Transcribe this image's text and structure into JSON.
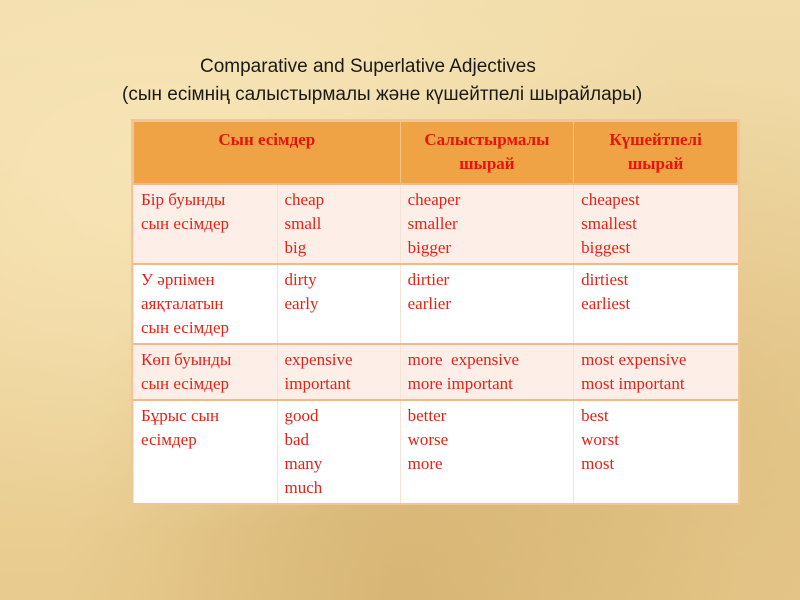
{
  "slide": {
    "title_en": "Comparative and Superlative Adjectives",
    "title_kz": "(сын есімнің салыстырмалы және күшейтпелі шырайлары)"
  },
  "table": {
    "headers": [
      "Сын есімдер",
      "Салыстырмалы шырай",
      "Күшейтпелі шырай"
    ],
    "rows": [
      {
        "category": [
          "Бір буынды",
          "сын есімдер"
        ],
        "base": [
          "cheap",
          "small",
          "big"
        ],
        "comparative": [
          "cheaper",
          "smaller",
          "bigger"
        ],
        "superlative": [
          "cheapest",
          "smallest",
          "biggest"
        ]
      },
      {
        "category": [
          "У әрпімен",
          "аяқталатын",
          "сын есімдер"
        ],
        "base": [
          "dirty",
          "early"
        ],
        "comparative": [
          "dirtier",
          "earlier"
        ],
        "superlative": [
          "dirtiest",
          "earliest"
        ]
      },
      {
        "category": [
          "Көп буынды",
          "сын есімдер"
        ],
        "base": [
          "expensive",
          "important"
        ],
        "comparative": [
          "more  expensive",
          "more important"
        ],
        "superlative": [
          "most expensive",
          "most important"
        ]
      },
      {
        "category": [
          "Бұрыс сын",
          "есімдер"
        ],
        "base": [
          "good",
          "bad",
          "many",
          "much"
        ],
        "comparative": [
          "better",
          "worse",
          "more"
        ],
        "superlative": [
          "best",
          "worst",
          "most"
        ]
      }
    ]
  },
  "colors": {
    "header_bg": "#f0a345",
    "text_red": "#e0231c",
    "row_tint": "#fdefe8",
    "background": "#efd7a1"
  }
}
